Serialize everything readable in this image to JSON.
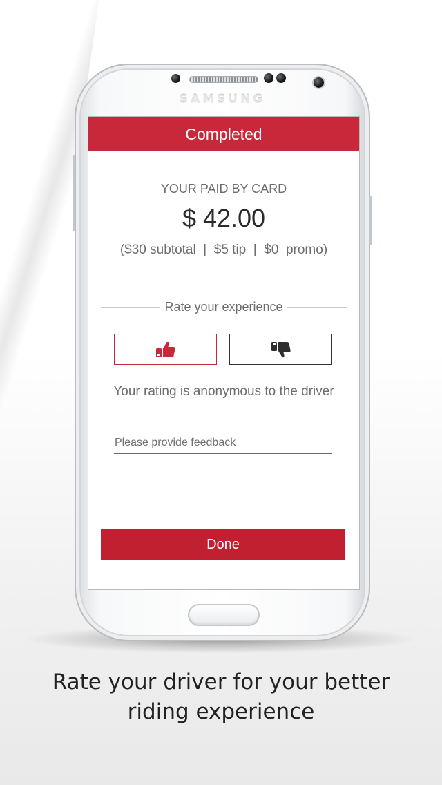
{
  "device": {
    "brand": "SAMSUNG"
  },
  "header": {
    "title": "Completed"
  },
  "payment": {
    "section_label": "YOUR PAID BY CARD",
    "amount": "$ 42.00",
    "breakdown": "($30 subtotal  |  $5 tip  |  $0  promo)"
  },
  "rating": {
    "section_label": "Rate your experience",
    "thumbs_up_icon": "thumbs-up-icon",
    "thumbs_down_icon": "thumbs-down-icon",
    "anonymous_note": "Your rating is anonymous to the driver"
  },
  "feedback": {
    "placeholder": "Please provide feedback",
    "value": ""
  },
  "actions": {
    "done_label": "Done"
  },
  "caption": {
    "line1": "Rate your driver for your better",
    "line2": "riding experience"
  },
  "colors": {
    "brand_red": "#c8283a",
    "done_red": "#c0202f",
    "text_gray": "#6d6d6d",
    "dark_icon": "#2e2e2e"
  }
}
